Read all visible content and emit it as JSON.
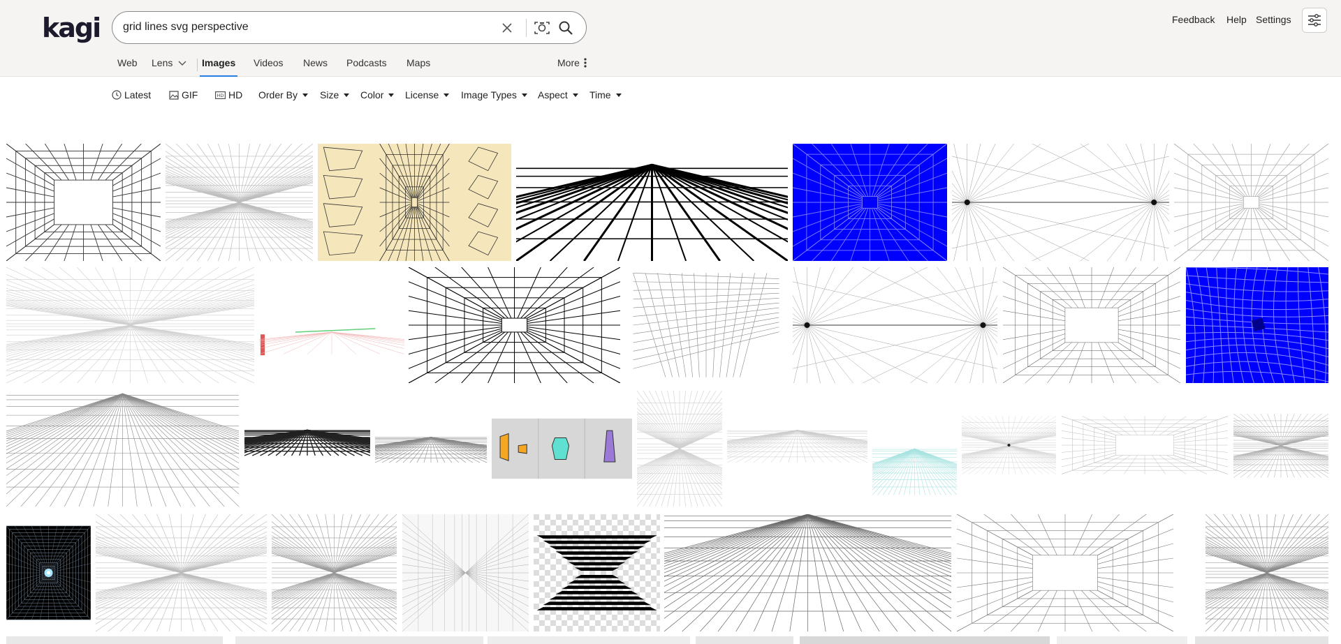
{
  "brand": {
    "logo": "kagi"
  },
  "search": {
    "query": "grid lines svg perspective"
  },
  "tabs": [
    "Web",
    "Lens",
    "Images",
    "Videos",
    "News",
    "Podcasts",
    "Maps"
  ],
  "active_tab": "Images",
  "more_label": "More",
  "top_links": {
    "feedback": "Feedback",
    "help": "Help",
    "settings": "Settings"
  },
  "filters": {
    "latest": "Latest",
    "gif": "GIF",
    "hd": "HD",
    "order_by": "Order By",
    "size": "Size",
    "color": "Color",
    "license": "License",
    "image_types": "Image Types",
    "aspect": "Aspect",
    "time": "Time"
  },
  "colors": {
    "accent": "#2a7de1",
    "header_bg": "#f5f4f2",
    "blue_thumb": "#0000ff",
    "beige_thumb": "#f5e6bb"
  },
  "icons": [
    "clear-icon",
    "camera-search-icon",
    "search-icon",
    "chevron-down-icon",
    "vertical-dots-icon",
    "sliders-icon",
    "clock-icon",
    "image-icon",
    "hd-icon"
  ]
}
